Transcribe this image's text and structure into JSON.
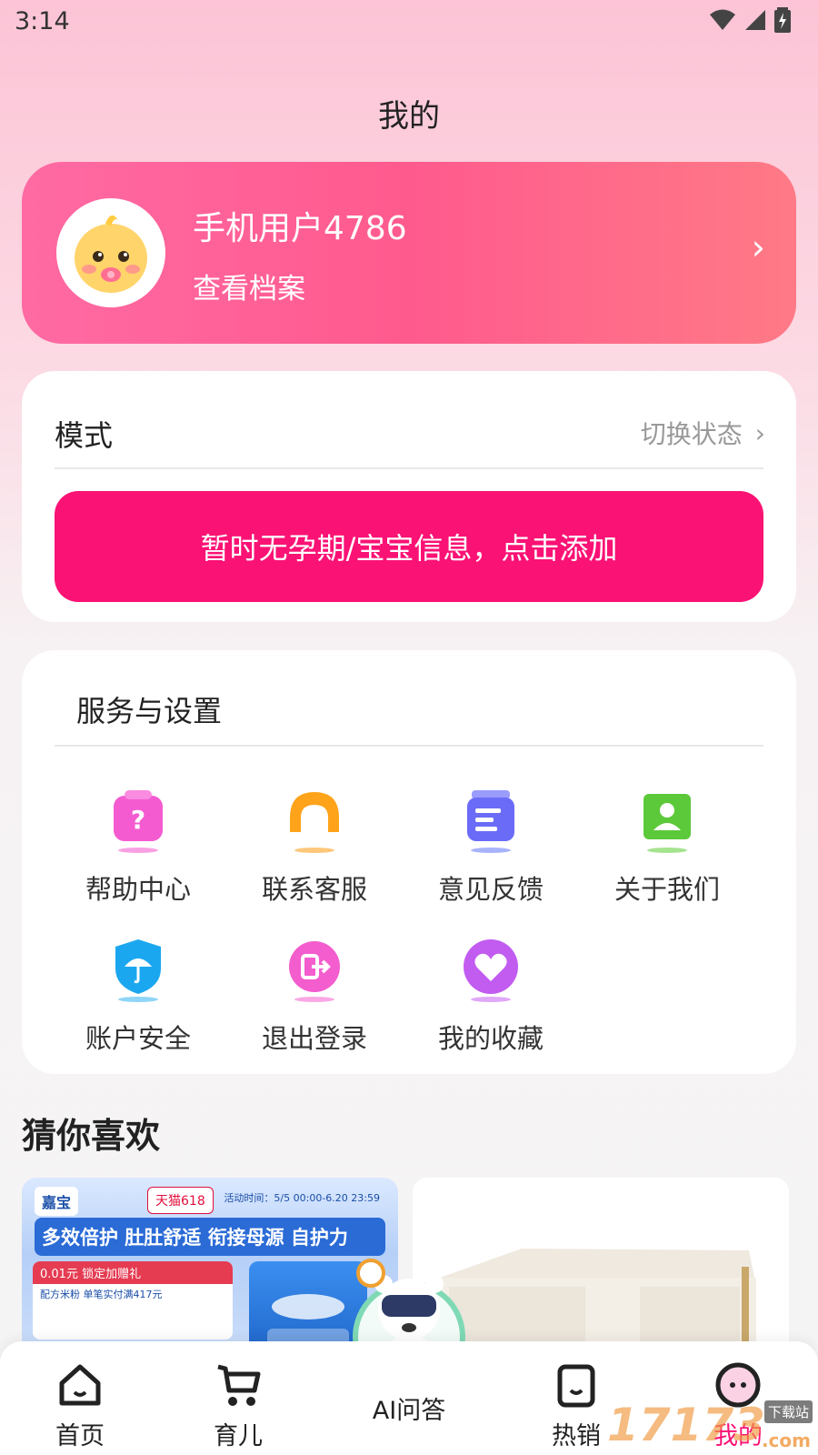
{
  "status_bar": {
    "time": "3:14"
  },
  "header": {
    "title": "我的"
  },
  "profile": {
    "name": "手机用户4786",
    "link": "查看档案",
    "arrow": "›"
  },
  "mode": {
    "label": "模式",
    "switch_label": "切换状态",
    "switch_arrow": "›",
    "add_button": "暂时无孕期/宝宝信息，点击添加"
  },
  "services": {
    "title": "服务与设置",
    "items": [
      {
        "label": "帮助中心",
        "icon": "help-icon",
        "color": "#f55bd0"
      },
      {
        "label": "联系客服",
        "icon": "headset-icon",
        "color": "#ffa31a"
      },
      {
        "label": "意见反馈",
        "icon": "feedback-icon",
        "color": "#6a6cf7"
      },
      {
        "label": "关于我们",
        "icon": "about-icon",
        "color": "#5cc93a"
      },
      {
        "label": "账户安全",
        "icon": "shield-umbrella-icon",
        "color": "#1ba7f0"
      },
      {
        "label": "退出登录",
        "icon": "logout-icon",
        "color": "#f35dce"
      },
      {
        "label": "我的收藏",
        "icon": "heart-icon",
        "color": "#c25cf0"
      }
    ]
  },
  "recommend": {
    "title": "猜你喜欢",
    "product_1": {
      "brand": "嘉宝",
      "tag": "天猫618",
      "time": "活动时间：5/5 00:00-6.20 23:59",
      "slogan": "多效倍护 肚肚舒适 衔接母源 自护力",
      "promo_head": "0.01元 锁定加赠礼",
      "promo_body": "配方米粉 单笔实付满417元"
    }
  },
  "bottom_nav": {
    "items": [
      {
        "label": "首页",
        "icon": "home-icon"
      },
      {
        "label": "育儿",
        "icon": "stroller-icon"
      },
      {
        "label": "AI问答",
        "icon": "ai-bear-icon"
      },
      {
        "label": "热销",
        "icon": "shopping-bag-icon"
      },
      {
        "label": "我的",
        "icon": "profile-icon"
      }
    ]
  },
  "watermark": {
    "text": "17173",
    "sub": "下载站",
    "domain": ".com"
  },
  "colors": {
    "primary": "#fb1275",
    "profile_gradient_start": "#ff6aa3",
    "profile_gradient_end": "#ff7a86"
  }
}
